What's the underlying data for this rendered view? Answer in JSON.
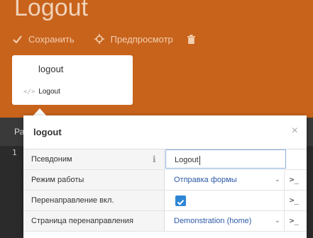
{
  "page": {
    "title": "Logout"
  },
  "toolbar": {
    "save_label": "Сохранить",
    "preview_label": "Предпросмотр"
  },
  "popup": {
    "title": "logout",
    "code_label": "Logout"
  },
  "editor": {
    "tab_label": "Ра",
    "line_number": "1"
  },
  "inspector": {
    "title": "logout",
    "close_glyph": "×",
    "prompt_glyph": ">_",
    "properties": [
      {
        "label": "Псевдоним",
        "value": "Logout"
      },
      {
        "label": "Режим работы",
        "value": "Отправка формы"
      },
      {
        "label": "Перенаправление вкл.",
        "value": "",
        "checked": true
      },
      {
        "label": "Страница перенаправления",
        "value": "Demonstration (home)"
      }
    ]
  },
  "colors": {
    "header_orange": "#c8631c",
    "checkbox_blue": "#2e86d6"
  }
}
